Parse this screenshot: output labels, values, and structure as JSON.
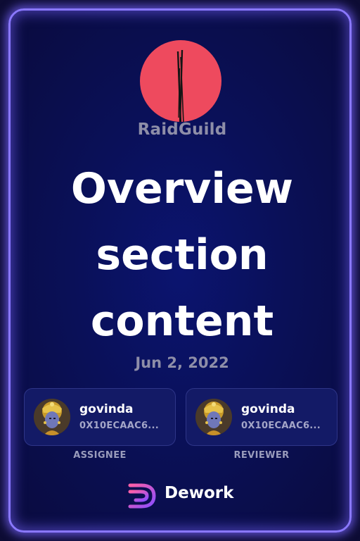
{
  "org": {
    "name": "RaidGuild",
    "logo_color": "#ee4a5e"
  },
  "task": {
    "title_lines": [
      "Overview",
      "section",
      "content"
    ],
    "date": "Jun 2, 2022"
  },
  "assignee": {
    "name": "govinda",
    "address": "0X10ECAAC6...",
    "role_label": "ASSIGNEE"
  },
  "reviewer": {
    "name": "govinda",
    "address": "0X10ECAAC6...",
    "role_label": "REVIEWER"
  },
  "brand": {
    "name": "Dework",
    "icon": "dework-logo-icon"
  },
  "colors": {
    "accent_glow": "#8a78ff",
    "background": "#0a1058",
    "muted_text": "#8e8ea8"
  }
}
